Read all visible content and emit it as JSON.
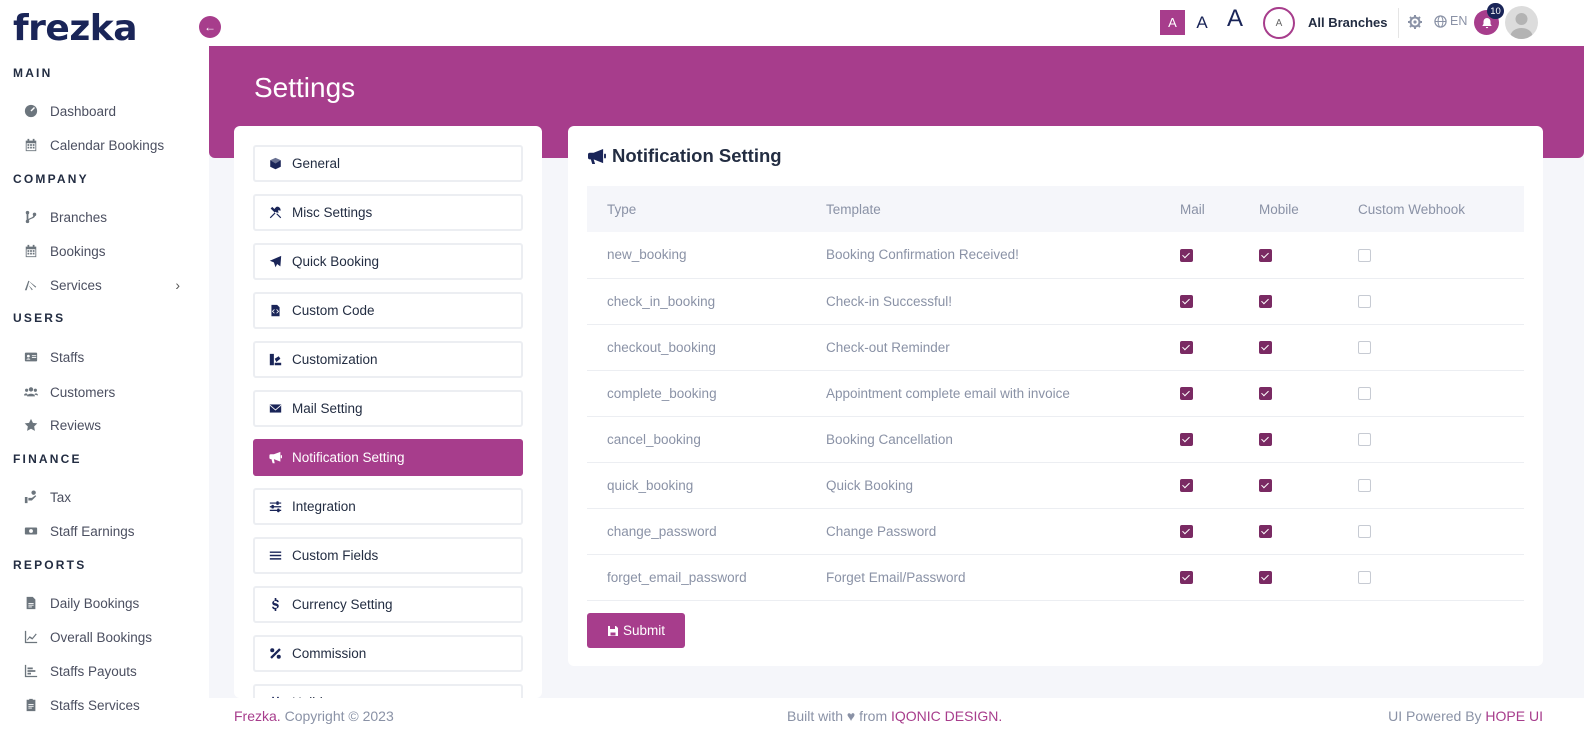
{
  "app": {
    "logo": "frezka"
  },
  "sidebar": {
    "sections": [
      {
        "title": "MAIN",
        "items": [
          {
            "label": "Dashboard",
            "icon": "dashboard-icon"
          },
          {
            "label": "Calendar Bookings",
            "icon": "calendar-icon"
          }
        ]
      },
      {
        "title": "COMPANY",
        "items": [
          {
            "label": "Branches",
            "icon": "branch-icon"
          },
          {
            "label": "Bookings",
            "icon": "calendar-icon"
          },
          {
            "label": "Services",
            "icon": "services-icon",
            "has_submenu": true
          }
        ]
      },
      {
        "title": "USERS",
        "items": [
          {
            "label": "Staffs",
            "icon": "id-card-icon"
          },
          {
            "label": "Customers",
            "icon": "users-icon"
          },
          {
            "label": "Reviews",
            "icon": "star-icon"
          }
        ]
      },
      {
        "title": "FINANCE",
        "items": [
          {
            "label": "Tax",
            "icon": "tax-icon"
          },
          {
            "label": "Staff Earnings",
            "icon": "money-icon"
          }
        ]
      },
      {
        "title": "REPORTS",
        "items": [
          {
            "label": "Daily Bookings",
            "icon": "file-icon"
          },
          {
            "label": "Overall Bookings",
            "icon": "line-chart-icon"
          },
          {
            "label": "Staffs Payouts",
            "icon": "bar-chart-icon"
          },
          {
            "label": "Staffs Services",
            "icon": "clipboard-icon"
          }
        ]
      }
    ]
  },
  "topbar": {
    "font_sizes": [
      "A",
      "A",
      "A"
    ],
    "branch_avatar": "A",
    "branch": "All Branches",
    "language": "EN",
    "notification_count": "10"
  },
  "page": {
    "title": "Settings"
  },
  "settings_menu": [
    {
      "label": "General",
      "icon": "cube-icon",
      "active": false
    },
    {
      "label": "Misc Settings",
      "icon": "tools-icon",
      "active": false
    },
    {
      "label": "Quick Booking",
      "icon": "paper-plane-icon",
      "active": false
    },
    {
      "label": "Custom Code",
      "icon": "file-code-icon",
      "active": false
    },
    {
      "label": "Customization",
      "icon": "palette-icon",
      "active": false
    },
    {
      "label": "Mail Setting",
      "icon": "envelope-icon",
      "active": false
    },
    {
      "label": "Notification Setting",
      "icon": "megaphone-icon",
      "active": true
    },
    {
      "label": "Integration",
      "icon": "sliders-icon",
      "active": false
    },
    {
      "label": "Custom Fields",
      "icon": "bars-icon",
      "active": false
    },
    {
      "label": "Currency Setting",
      "icon": "dollar-icon",
      "active": false
    },
    {
      "label": "Commission",
      "icon": "percent-icon",
      "active": false
    },
    {
      "label": "Holidays",
      "icon": "calendar-icon",
      "active": false
    }
  ],
  "notification": {
    "title": "Notification Setting",
    "columns": [
      "Type",
      "Template",
      "Mail",
      "Mobile",
      "Custom Webhook"
    ],
    "rows": [
      {
        "type": "new_booking",
        "template": "Booking Confirmation Received!",
        "mail": true,
        "mobile": true,
        "webhook": false
      },
      {
        "type": "check_in_booking",
        "template": "Check-in Successful!",
        "mail": true,
        "mobile": true,
        "webhook": false
      },
      {
        "type": "checkout_booking",
        "template": "Check-out Reminder",
        "mail": true,
        "mobile": true,
        "webhook": false
      },
      {
        "type": "complete_booking",
        "template": "Appointment complete email with invoice",
        "mail": true,
        "mobile": true,
        "webhook": false
      },
      {
        "type": "cancel_booking",
        "template": "Booking Cancellation",
        "mail": true,
        "mobile": true,
        "webhook": false
      },
      {
        "type": "quick_booking",
        "template": "Quick Booking",
        "mail": true,
        "mobile": true,
        "webhook": false
      },
      {
        "type": "change_password",
        "template": "Change Password",
        "mail": true,
        "mobile": true,
        "webhook": false
      },
      {
        "type": "forget_email_password",
        "template": "Forget Email/Password",
        "mail": true,
        "mobile": true,
        "webhook": false
      }
    ],
    "submit_label": "Submit"
  },
  "footer": {
    "brand": "Frezka.",
    "copyright": " Copyright © 2023",
    "built_with": "Built with ♥ from ",
    "built_brand": "IQONIC DESIGN.",
    "powered": "UI Powered By ",
    "powered_brand": "HOPE UI"
  },
  "colors": {
    "primary": "#a73d8c",
    "dark": "#1a2558",
    "checkbox": "#7a2a63"
  }
}
